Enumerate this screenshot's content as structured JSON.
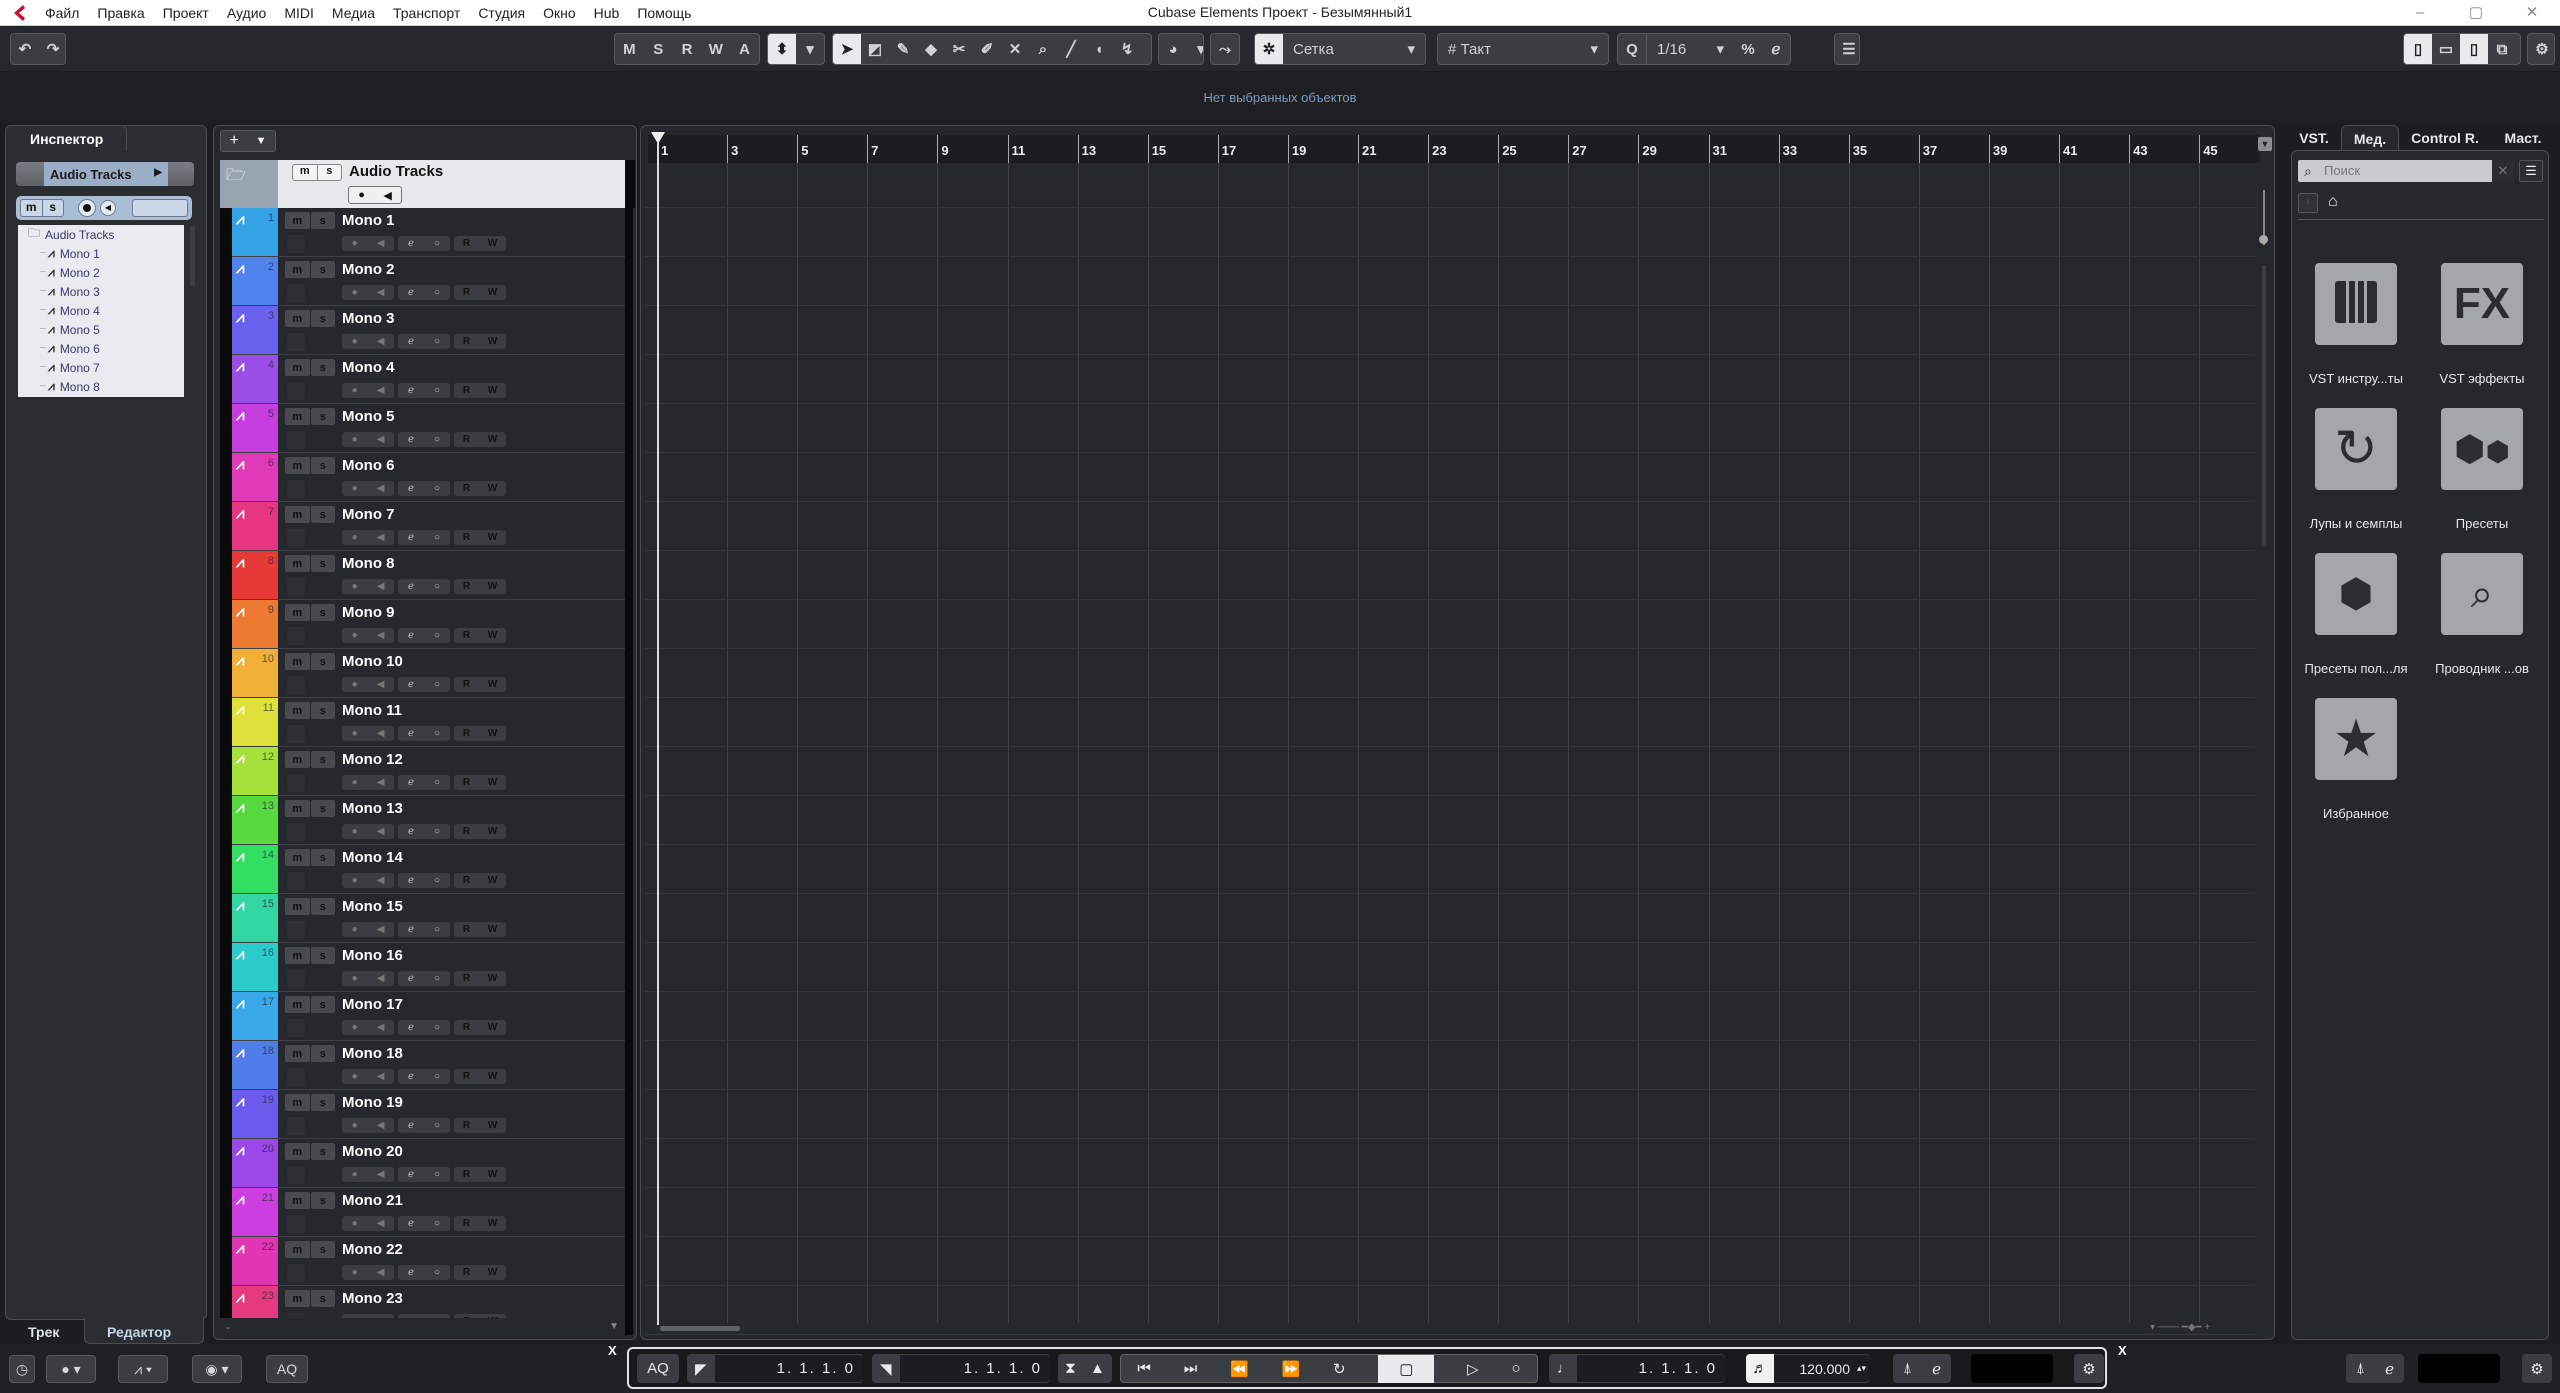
{
  "app": {
    "title": "Cubase Elements Проект - Безымянный1",
    "menu": [
      "Файл",
      "Правка",
      "Проект",
      "Аудио",
      "MIDI",
      "Медиа",
      "Транспорт",
      "Студия",
      "Окно",
      "Hub",
      "Помощь"
    ]
  },
  "toolbar": {
    "mode_buttons": [
      "M",
      "S",
      "R",
      "W",
      "A"
    ],
    "snap_type": "Сетка",
    "grid_type": "Такт",
    "quantize_label": "Q",
    "quantize_value": "1/16",
    "grid_icon": "#"
  },
  "info_line": "Нет выбранных объектов",
  "inspector": {
    "tab": "Инспектор",
    "selected_track": "Audio Tracks",
    "tree_root": "Audio Tracks",
    "tree_items": [
      "Mono 1",
      "Mono 2",
      "Mono 3",
      "Mono 4",
      "Mono 5",
      "Mono 6",
      "Mono 7",
      "Mono 8"
    ],
    "mute_label": "m",
    "solo_label": "s",
    "bottom_tabs": [
      "Трек",
      "Редактор"
    ]
  },
  "tracklist": {
    "folder": {
      "name": "Audio Tracks",
      "mute": "m",
      "solo": "s"
    },
    "tracks": [
      {
        "num": "1",
        "name": "Mono 1",
        "color": "#35a3e6"
      },
      {
        "num": "2",
        "name": "Mono 2",
        "color": "#4f82ea"
      },
      {
        "num": "3",
        "name": "Mono 3",
        "color": "#6a62ee"
      },
      {
        "num": "4",
        "name": "Mono 4",
        "color": "#9b4fe6"
      },
      {
        "num": "5",
        "name": "Mono 5",
        "color": "#c63ee0"
      },
      {
        "num": "6",
        "name": "Mono 6",
        "color": "#e03ab8"
      },
      {
        "num": "7",
        "name": "Mono 7",
        "color": "#e63682"
      },
      {
        "num": "8",
        "name": "Mono 8",
        "color": "#e63a36"
      },
      {
        "num": "9",
        "name": "Mono 9",
        "color": "#ec7a32"
      },
      {
        "num": "10",
        "name": "Mono 10",
        "color": "#f0b038"
      },
      {
        "num": "11",
        "name": "Mono 11",
        "color": "#dfe03a"
      },
      {
        "num": "12",
        "name": "Mono 12",
        "color": "#a6e03a"
      },
      {
        "num": "13",
        "name": "Mono 13",
        "color": "#56d83e"
      },
      {
        "num": "14",
        "name": "Mono 14",
        "color": "#34de62"
      },
      {
        "num": "15",
        "name": "Mono 15",
        "color": "#32d6a0"
      },
      {
        "num": "16",
        "name": "Mono 16",
        "color": "#2ccccc"
      },
      {
        "num": "17",
        "name": "Mono 17",
        "color": "#38a8e8"
      },
      {
        "num": "18",
        "name": "Mono 18",
        "color": "#4f7ee8"
      },
      {
        "num": "19",
        "name": "Mono 19",
        "color": "#6c5aec"
      },
      {
        "num": "20",
        "name": "Mono 20",
        "color": "#9a48e8"
      },
      {
        "num": "21",
        "name": "Mono 21",
        "color": "#cc3ee0"
      },
      {
        "num": "22",
        "name": "Mono 22",
        "color": "#e036b4"
      },
      {
        "num": "23",
        "name": "Mono 23",
        "color": "#e63a7e"
      }
    ],
    "track_buttons": {
      "mute": "m",
      "solo": "s",
      "read": "R",
      "write": "W"
    }
  },
  "ruler": {
    "labels": [
      "1",
      "3",
      "5",
      "7",
      "9",
      "11",
      "13",
      "15",
      "17",
      "19",
      "21",
      "23",
      "25",
      "27",
      "29",
      "31",
      "33",
      "35",
      "37",
      "39",
      "41",
      "43",
      "45"
    ]
  },
  "right_zone": {
    "tabs": [
      "VST.",
      "Мед.",
      "Control R.",
      "Маст."
    ],
    "active_tab": "Мед.",
    "search_placeholder": "Поиск",
    "tiles": [
      {
        "label": "VST инстру...ты",
        "icon": "piano-keys-icon"
      },
      {
        "label": "VST эффекты",
        "icon": "fx-icon"
      },
      {
        "label": "Лупы и семплы",
        "icon": "loop-icon"
      },
      {
        "label": "Пресеты",
        "icon": "hexagons-icon"
      },
      {
        "label": "Пресеты пол...ля",
        "icon": "user-preset-icon"
      },
      {
        "label": "Проводник ...ов",
        "icon": "file-browser-icon"
      },
      {
        "label": "Избранное",
        "icon": "star-icon"
      }
    ]
  },
  "transport": {
    "aq_label": "AQ",
    "left_locator": "1. 1. 1.   0",
    "right_locator": "1. 1. 1.   0",
    "position": "1. 1. 1.   0",
    "tempo": "120.000"
  }
}
